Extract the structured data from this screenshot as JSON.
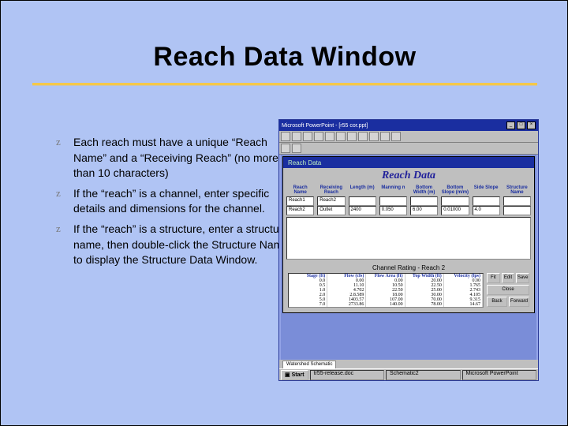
{
  "title": "Reach Data Window",
  "bullets": [
    "Each reach must have a unique “Reach Name” and a “Receiving Reach” (no more than 10 characters)",
    "If the “reach” is a channel, enter specific details and dimensions for the channel.",
    "If the “reach” is a structure, enter a structure name, then double-click the Structure Name to display the Structure Data Window."
  ],
  "window": {
    "title": "Microsoft PowerPoint - [r55 cor.ppt]",
    "inner_title": "Reach Data",
    "form_title": "Reach Data",
    "col_heads": [
      "Reach Name",
      "Receiving Reach",
      "Length (m)",
      "Manning n",
      "Bottom Width (m)",
      "Bottom Slope (m/m)",
      "Side Slope",
      "Structure Name"
    ],
    "rows": [
      [
        "Reach1",
        "Reach2",
        "",
        "",
        "",
        "",
        "",
        ""
      ],
      [
        "Reach2",
        "Outlet",
        "2400",
        "0.050",
        "6.00",
        "0.01000",
        "4.0",
        ""
      ]
    ],
    "rating": {
      "title": "Channel Rating - Reach 2",
      "heads": [
        "Stage (ft)",
        "Flow (cfs)",
        "Flow Area (ft)",
        "Top Width (ft)",
        "Velocity (fps)"
      ],
      "rows": [
        [
          "0.0",
          "0.00",
          "0.00",
          "20.00",
          "0.00"
        ],
        [
          "0.5",
          "11.10",
          "10.50",
          "22.50",
          "1.765"
        ],
        [
          "1.0",
          "4.702",
          "22.50",
          "25.00",
          "2.743"
        ],
        [
          "2.0",
          "2.8.589",
          "18.00",
          "30.00",
          "4.105"
        ],
        [
          "5.0",
          "1403.57",
          "107.00",
          "70.00",
          "9.315"
        ],
        [
          "7.0",
          "2733.86",
          "140.00",
          "78.00",
          "14.67"
        ]
      ]
    },
    "buttons": {
      "fit": "Fit",
      "edit": "Edit",
      "save": "Save",
      "close": "Close",
      "back": "Back",
      "forward": "Forward"
    },
    "tabs": [
      "Watershed Schematic"
    ],
    "taskbar": {
      "start": "Start",
      "items": [
        "tr55-release.doc",
        "Schematic2",
        "Microsoft PowerPoint"
      ]
    }
  }
}
